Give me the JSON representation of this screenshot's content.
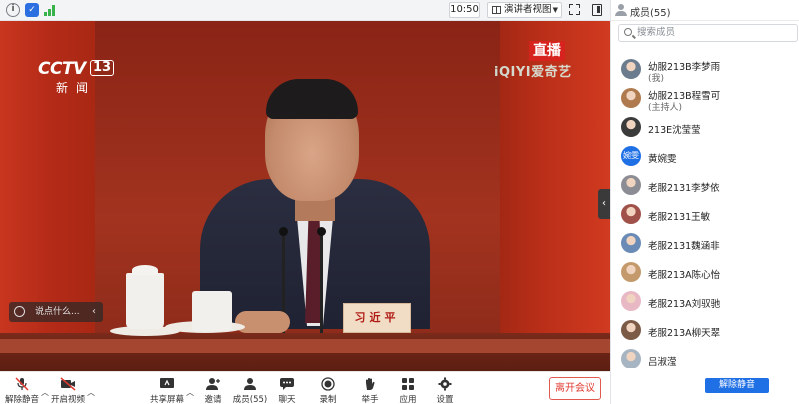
{
  "topbar": {
    "time": "10:50",
    "view_mode": "演讲者视图",
    "icons": [
      "info-icon",
      "shield-icon",
      "signal-icon",
      "fullscreen-icon",
      "sidebar-toggle-icon"
    ]
  },
  "video": {
    "channel_logo": "CCTV",
    "channel_number": "13",
    "channel_sub": "新闻",
    "live_badge": "直播",
    "watermark": "iQIYI爱奇艺",
    "nameplate": "习近平",
    "chat_placeholder": "说点什么...",
    "chat_arrow": "‹",
    "collapse_arrow": "‹"
  },
  "toolbar": {
    "unmute": "解除静音",
    "start_video": "开启视频",
    "share_screen": "共享屏幕",
    "invite": "邀请",
    "members": "成员(55)",
    "chat": "聊天",
    "record": "录制",
    "raise_hand": "举手",
    "apps": "应用",
    "settings": "设置",
    "leave": "离开会议"
  },
  "sidebar": {
    "title": "成员(55)",
    "search_placeholder": "搜索成员",
    "members": [
      {
        "name": "幼服213B李梦雨",
        "role": "(我)",
        "color": "#6b7c8f"
      },
      {
        "name": "幼服213B程雪可",
        "role": "(主持人)",
        "color": "#b07a4f"
      },
      {
        "name": "213E沈莹莹",
        "role": "",
        "color": "#3b3b3b"
      },
      {
        "name": "黄婉雯",
        "role": "",
        "color": "#1f6fe5",
        "initials": "婉雯"
      },
      {
        "name": "老服2131李梦依",
        "role": "",
        "color": "#8c8c94"
      },
      {
        "name": "老服2131王敏",
        "role": "",
        "color": "#a0524a"
      },
      {
        "name": "老服2131魏涵非",
        "role": "",
        "color": "#6a8bb5"
      },
      {
        "name": "老服213A陈心怡",
        "role": "",
        "color": "#c49a6c"
      },
      {
        "name": "老服213A刘驭驰",
        "role": "",
        "color": "#e8b8c4"
      },
      {
        "name": "老服213A柳天翠",
        "role": "",
        "color": "#7b5a46"
      },
      {
        "name": "吕淑滢",
        "role": "",
        "color": "#a7b4c2"
      }
    ],
    "unmute_all": "解除静音"
  }
}
